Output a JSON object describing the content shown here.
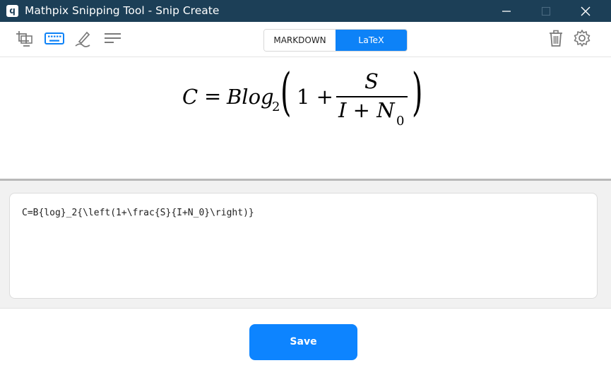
{
  "window": {
    "title": "Mathpix Snipping Tool - Snip Create",
    "logo_glyph": "ϥ"
  },
  "toolbar": {
    "tools": [
      "snip-icon",
      "keyboard-icon",
      "draw-icon",
      "list-icon"
    ],
    "mode_markdown": "MARKDOWN",
    "mode_latex": "LaTeX",
    "active_mode": "LaTeX",
    "right_tools": [
      "trash-icon",
      "gear-icon"
    ]
  },
  "preview": {
    "lhs": "C",
    "equals": "=",
    "rhs_b": "Blog",
    "rhs_sub": "2",
    "one_plus": "1 +",
    "numerator": "S",
    "denominator_main": "I + N",
    "denominator_sub": "0",
    "left_paren": "(",
    "right_paren": ")"
  },
  "editor": {
    "latex": "C=B{log}_2{\\left(1+\\frac{S}{I+N_0}\\right)}"
  },
  "actions": {
    "save_label": "Save"
  },
  "colors": {
    "titlebar": "#1c3f57",
    "accent": "#0d82f7",
    "save": "#0d84ff"
  }
}
